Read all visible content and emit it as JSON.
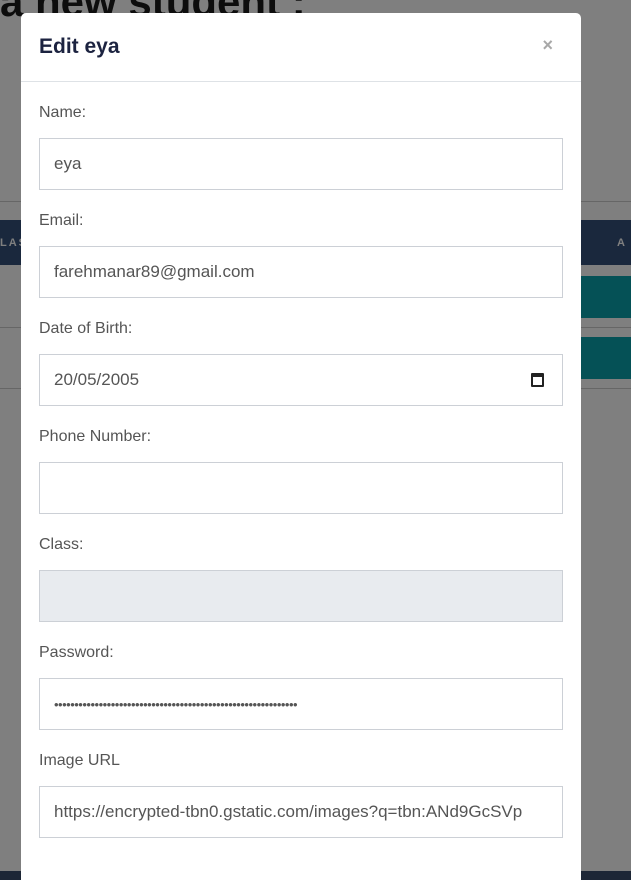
{
  "background": {
    "page_heading": "a new student :",
    "table_header_left": "LAS",
    "table_header_right": "A"
  },
  "modal": {
    "title": "Edit eya",
    "close_label": "×",
    "fields": {
      "name": {
        "label": "Name:",
        "value": "eya"
      },
      "email": {
        "label": "Email:",
        "value": "farehmanar89@gmail.com"
      },
      "dob": {
        "label": "Date of Birth:",
        "value": "20/05/2005"
      },
      "phone": {
        "label": "Phone Number:",
        "value": ""
      },
      "class": {
        "label": "Class:",
        "value": ""
      },
      "password": {
        "label": "Password:",
        "value": "••••••••••••••••••••••••••••••••••••••••••••••••••••••••••••"
      },
      "image_url": {
        "label": "Image URL",
        "value": "https://encrypted-tbn0.gstatic.com/images?q=tbn:ANd9GcSVp"
      }
    }
  }
}
